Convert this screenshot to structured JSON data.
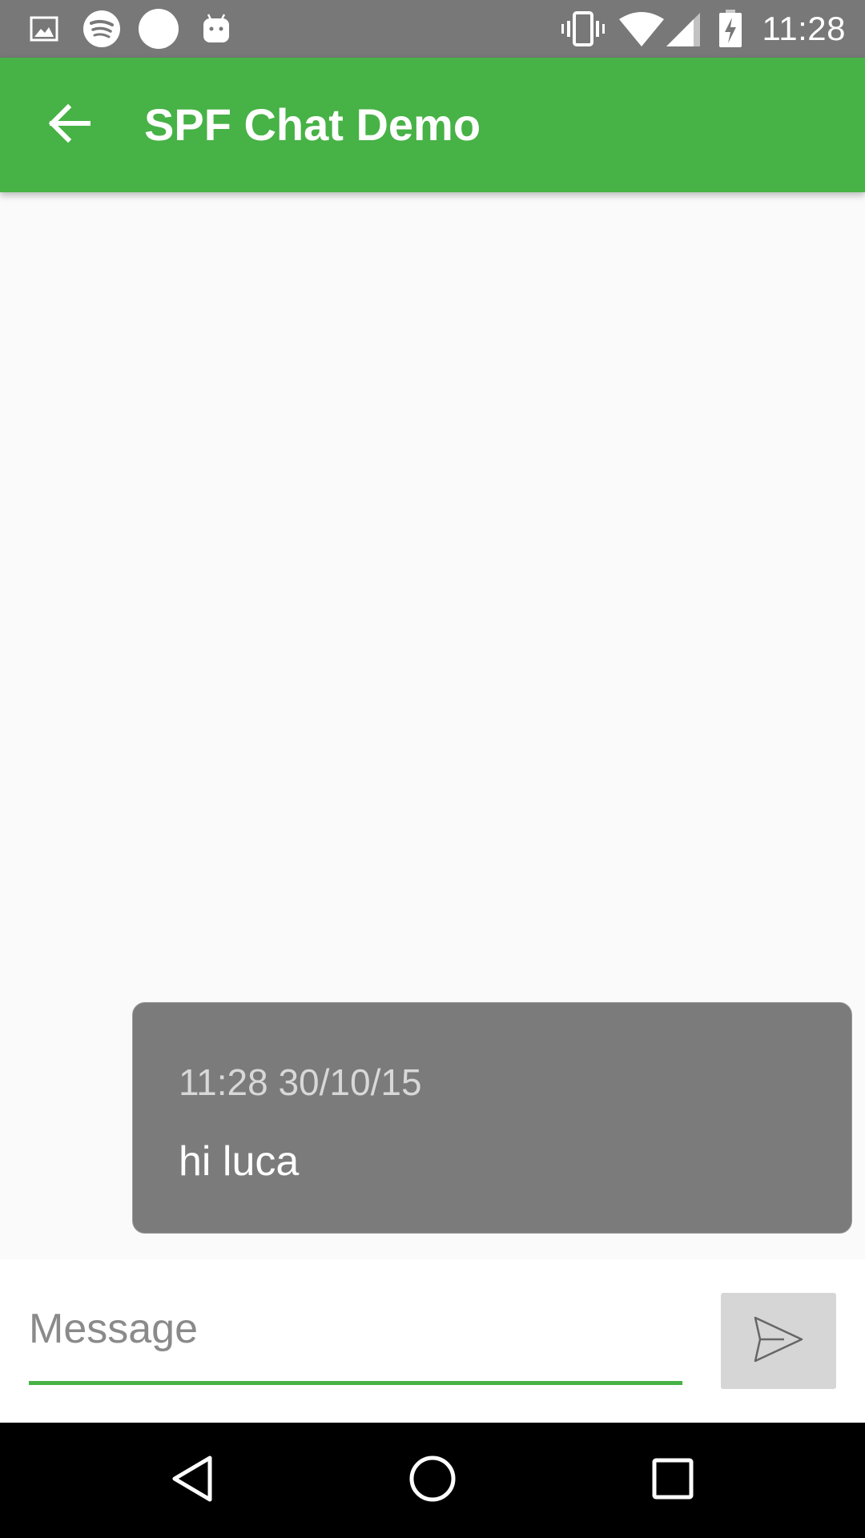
{
  "status_bar": {
    "time": "11:28",
    "left_icons": [
      "image-icon",
      "spotify-icon",
      "circle-icon",
      "android-icon"
    ],
    "right_icons": [
      "vibrate-icon",
      "wifi-icon",
      "signal-icon",
      "battery-charging-icon"
    ]
  },
  "app_bar": {
    "title": "SPF Chat Demo",
    "back_icon": "arrow-back-icon",
    "color": "#47b246"
  },
  "messages": [
    {
      "timestamp": "11:28 30/10/15",
      "text": "hi luca"
    }
  ],
  "composer": {
    "placeholder": "Message",
    "value": "",
    "send_icon": "send-icon"
  },
  "nav_bar": {
    "buttons": [
      "back-triangle-icon",
      "home-circle-icon",
      "recents-square-icon"
    ]
  },
  "colors": {
    "accent": "#47b246",
    "status_bar": "#787878",
    "bubble": "#7b7b7b",
    "send_button_bg": "#d6d6d6"
  }
}
